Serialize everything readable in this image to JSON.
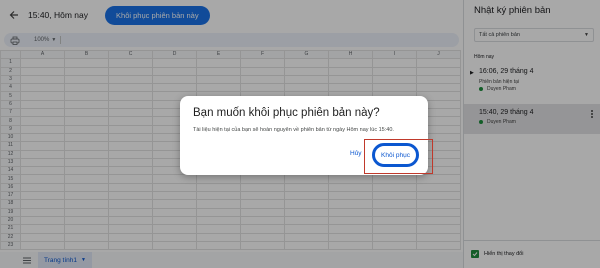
{
  "header": {
    "title": "15:40, Hôm nay",
    "restore_button": "Khôi phục phiên bản này"
  },
  "toolbar": {
    "zoom": "100%"
  },
  "grid": {
    "columns": [
      "A",
      "B",
      "C",
      "D",
      "E",
      "F",
      "G",
      "H",
      "I",
      "J"
    ],
    "rows": [
      "1",
      "2",
      "3",
      "4",
      "5",
      "6",
      "7",
      "8",
      "9",
      "10",
      "11",
      "12",
      "13",
      "14",
      "15",
      "16",
      "17",
      "18",
      "19",
      "20",
      "21",
      "22",
      "23"
    ]
  },
  "sheetbar": {
    "sheet_name": "Trang tính1"
  },
  "panel": {
    "title": "Nhật ký phiên bản",
    "filter": "Tất cả phiên bản",
    "section": "Hôm nay",
    "versions": [
      {
        "time": "16:06, 29 tháng 4",
        "subtitle": "Phiên bản hiện tại",
        "author": "Duyen Pham"
      },
      {
        "time": "15:40, 29 tháng 4",
        "author": "Duyen Pham"
      }
    ],
    "show_changes": "Hiển thị thay đổi"
  },
  "dialog": {
    "title": "Bạn muốn khôi phục phiên bản này?",
    "body": "Tài liệu hiện tại của bạn sẽ hoàn nguyên về phiên bản từ ngày Hôm nay lúc 15:40.",
    "cancel": "Hủy",
    "confirm": "Khôi phục"
  },
  "colors": {
    "accent": "#1a73e8",
    "highlight": "#c0392b",
    "author_dot": "#1e8e3e"
  }
}
